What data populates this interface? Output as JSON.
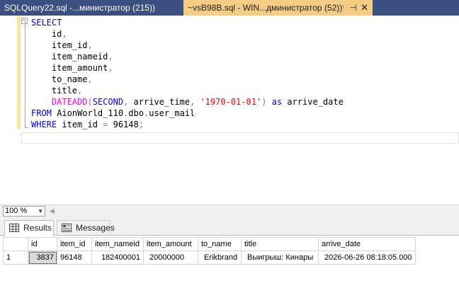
{
  "tabs": [
    {
      "label": "SQLQuery22.sql -...министратор (215))",
      "active": false,
      "close": ""
    },
    {
      "label": "~vsB98B.sql - WIN...дминистратор (52))*",
      "active": true,
      "pin": "⊣",
      "close": "✕"
    }
  ],
  "editor": {
    "collapse_glyph": "−",
    "lines": [
      "SELECT",
      "    id,",
      "    item_id,",
      "    item_nameid,",
      "    item_amount,",
      "    to_name,",
      "    title,",
      "    DATEADD(SECOND, arrive_time, '1970-01-01') as arrive_date",
      "FROM AionWorld_110.dbo.user_mail",
      "WHERE item_id = 96148;"
    ]
  },
  "zoom": {
    "value": "100 %"
  },
  "results_tabs": [
    {
      "label": "Results",
      "active": true,
      "icon": "grid-icon"
    },
    {
      "label": "Messages",
      "active": false,
      "icon": "messages-icon"
    }
  ],
  "grid": {
    "columns": [
      "id",
      "item_id",
      "item_nameid",
      "item_amount",
      "to_name",
      "title",
      "arrive_date"
    ],
    "rows": [
      {
        "rownum": "1",
        "cells": [
          "3837",
          "96148",
          "182400001",
          "20000000",
          "Erikbrand",
          "Выигрыш: Кинары",
          "2026-06-26 08:18:05.000"
        ]
      }
    ]
  }
}
